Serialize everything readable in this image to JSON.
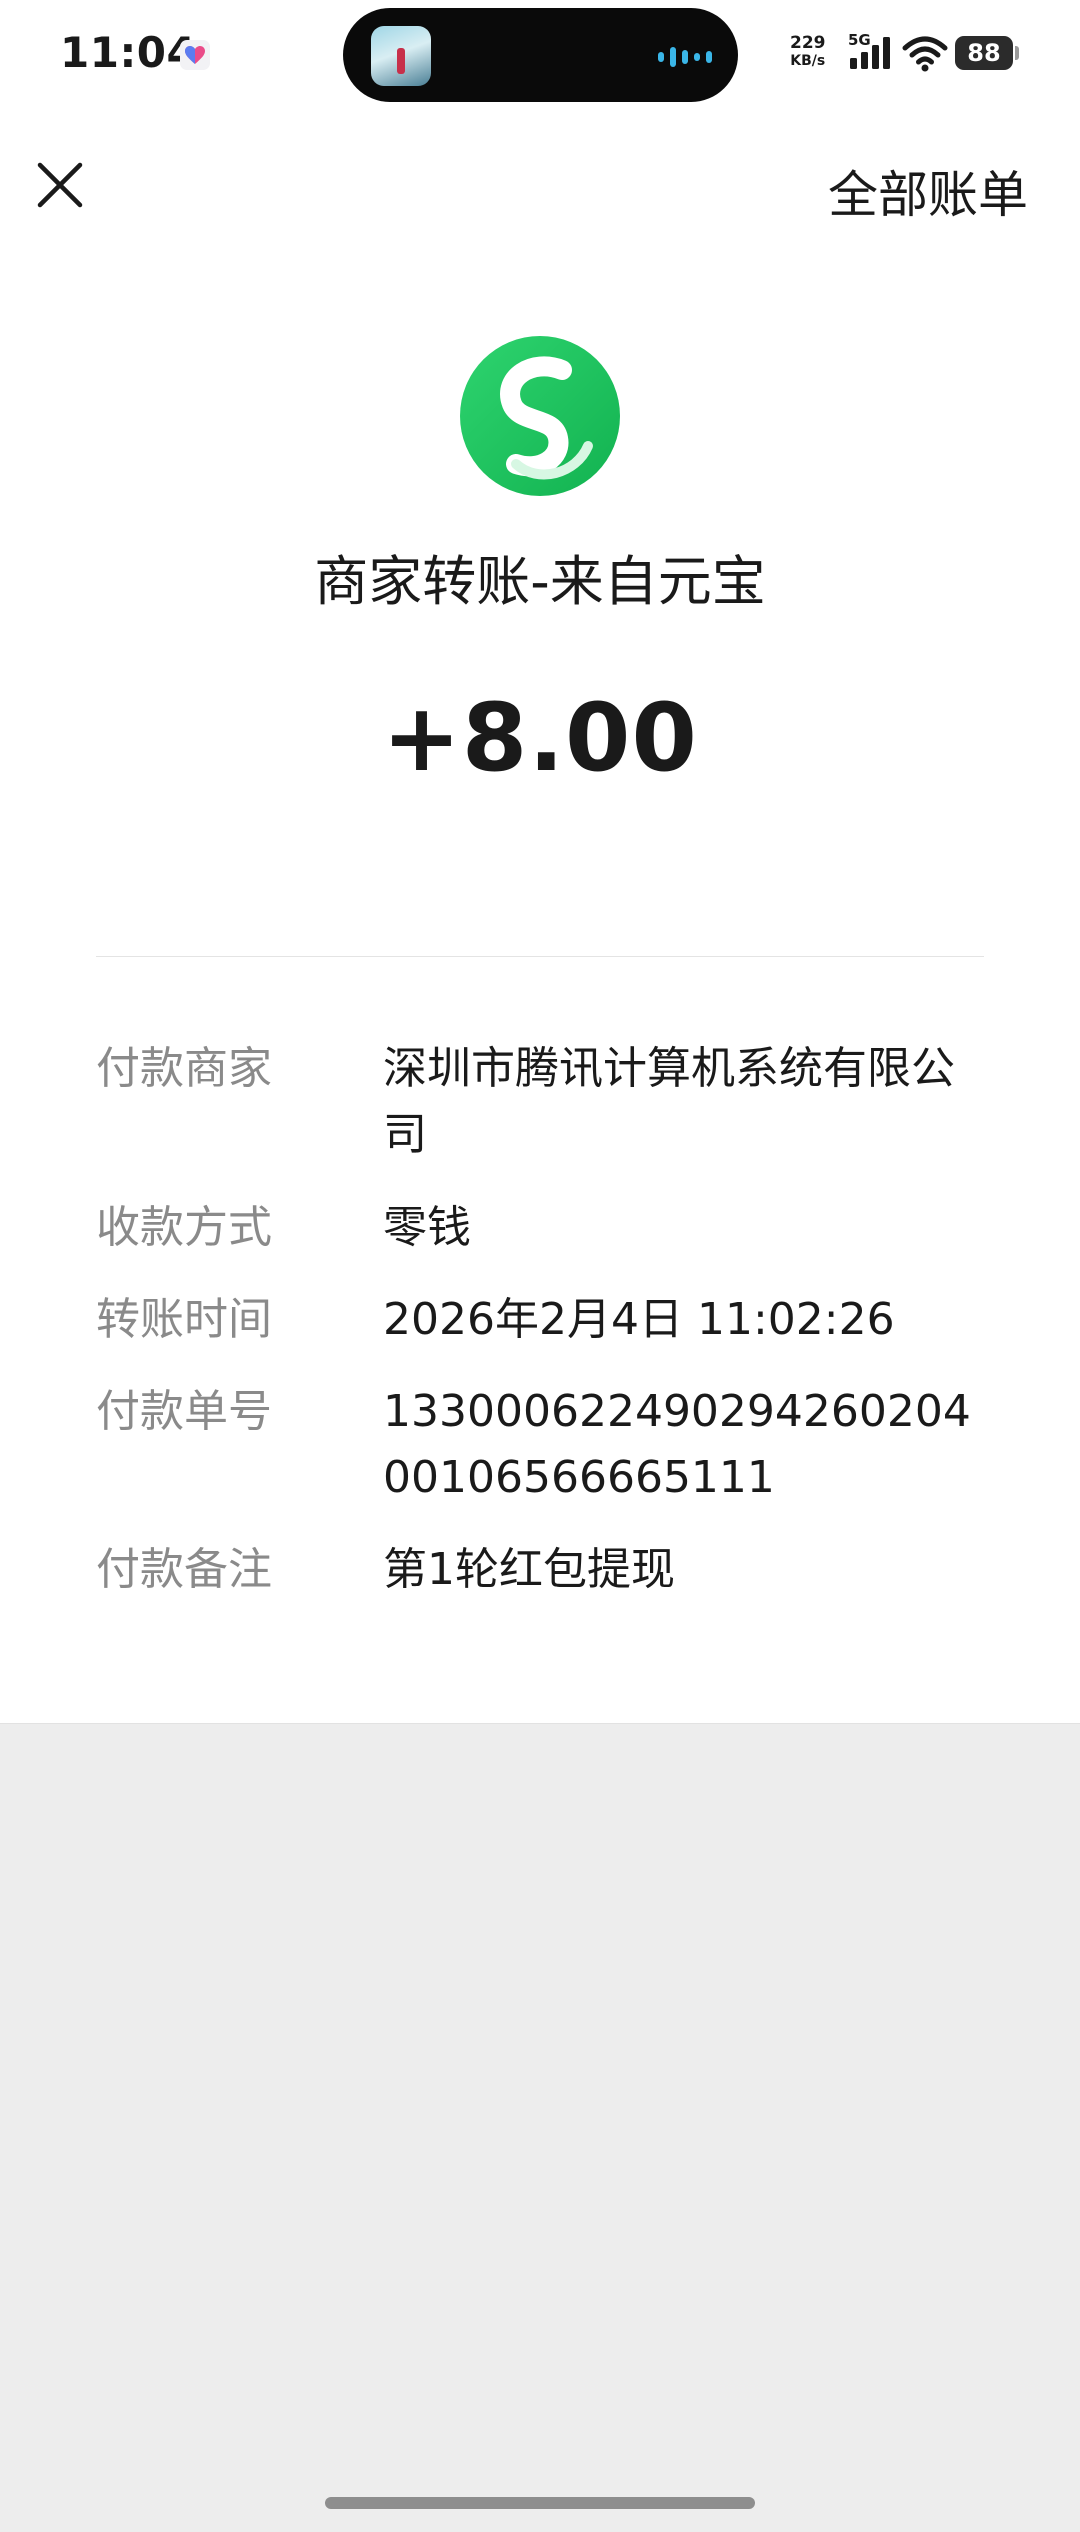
{
  "status_bar": {
    "time": "11:04",
    "net_speed_value": "229",
    "net_speed_unit": "KB/s",
    "network_type": "5G",
    "battery": "88"
  },
  "nav": {
    "all_bills_label": "全部账单"
  },
  "transaction": {
    "merchant_title": "商家转账-来自元宝",
    "amount": "+8.00",
    "logo_color": "#1ec45e"
  },
  "details": [
    {
      "label": "付款商家",
      "value": "深圳市腾讯计算机系统有限公司"
    },
    {
      "label": "收款方式",
      "value": "零钱"
    },
    {
      "label": "转账时间",
      "value": "2026年2月4日 11:02:26"
    },
    {
      "label": "付款单号",
      "value": "13300062249029426020400106566665111"
    },
    {
      "label": "付款备注",
      "value": "第1轮红包提现"
    }
  ]
}
